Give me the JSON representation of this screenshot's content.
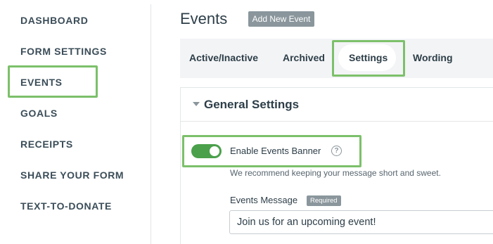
{
  "sidebar": {
    "items": [
      {
        "label": "DASHBOARD"
      },
      {
        "label": "FORM SETTINGS"
      },
      {
        "label": "EVENTS"
      },
      {
        "label": "GOALS"
      },
      {
        "label": "RECEIPTS"
      },
      {
        "label": "SHARE YOUR FORM"
      },
      {
        "label": "TEXT-TO-DONATE"
      }
    ],
    "selected": "EVENTS"
  },
  "header": {
    "title": "Events",
    "add_button_label": "Add New Event"
  },
  "tabs": [
    {
      "label": "Active/Inactive"
    },
    {
      "label": "Archived"
    },
    {
      "label": "Settings"
    },
    {
      "label": "Wording"
    }
  ],
  "active_tab": "Settings",
  "general_settings": {
    "section_title": "General Settings",
    "toggle_label": "Enable Events Banner",
    "toggle_on": true,
    "help_icon": "?",
    "hint": "We recommend keeping your message short and sweet.",
    "message_label": "Events Message",
    "required_label": "Required",
    "message_value": "Join us for an upcoming event!"
  },
  "colors": {
    "highlight": "#7cc06a",
    "toggle_on": "#4aa04b",
    "badge": "#8a969c",
    "text": "#2d3e48"
  }
}
